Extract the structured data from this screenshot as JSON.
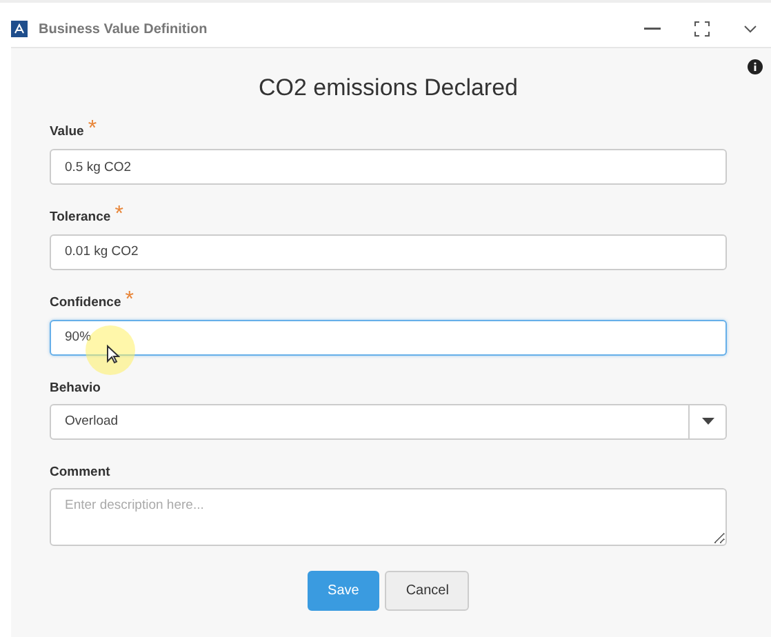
{
  "window": {
    "title": "Business Value Definition"
  },
  "heading": "CO2 emissions Declared",
  "fields": [
    {
      "kind": "text",
      "label": "Value",
      "required_mark": "*",
      "value": "0.5 kg CO2",
      "focused": false
    },
    {
      "kind": "text",
      "label": "Tolerance",
      "required_mark": "*",
      "value": "0.01 kg CO2",
      "focused": false
    },
    {
      "kind": "text",
      "label": "Confidence",
      "required_mark": "*",
      "value": "90%",
      "focused": true
    },
    {
      "kind": "select",
      "label": "Behavio",
      "value": "Overload",
      "focused": false
    },
    {
      "kind": "textarea",
      "label": "Comment",
      "placeholder": "Enter description here...",
      "focused": false
    }
  ],
  "buttons": [
    {
      "kind": "primary",
      "label": "Save"
    },
    {
      "kind": "secondary",
      "label": "Cancel"
    }
  ]
}
